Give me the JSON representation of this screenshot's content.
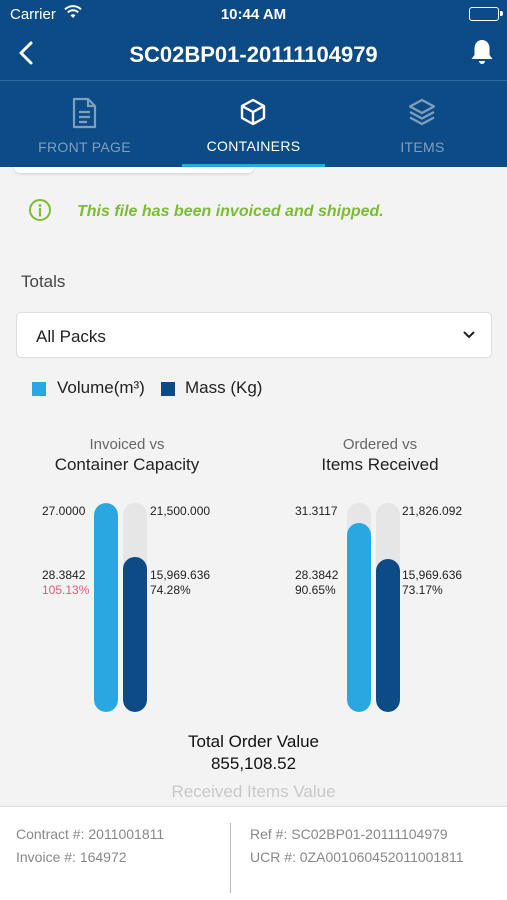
{
  "status_bar": {
    "carrier": "Carrier",
    "time": "10:44 AM"
  },
  "header": {
    "title": "SC02BP01-20111104979"
  },
  "tabs": [
    {
      "label": "FRONT PAGE",
      "icon": "document-icon",
      "active": false
    },
    {
      "label": "CONTAINERS",
      "icon": "box-icon",
      "active": true
    },
    {
      "label": "ITEMS",
      "icon": "layers-icon",
      "active": false
    }
  ],
  "notice": {
    "text": "This file has been invoiced and shipped.",
    "color": "#7bbc32"
  },
  "totals_label": "Totals",
  "pack_select": {
    "value": "All Packs"
  },
  "legend": [
    {
      "label": "Volume(m³)",
      "color": "#29a8e0"
    },
    {
      "label": "Mass (Kg)",
      "color": "#0d4b86"
    }
  ],
  "chart_data": [
    {
      "type": "bar",
      "title_line1": "Invoiced vs",
      "title_line2": "Container Capacity",
      "volume": {
        "top_label": "27.0000",
        "value_label": "28.3842",
        "percent_label": "105.13%",
        "fill": 1.0
      },
      "mass": {
        "top_label": "21,500.000",
        "value_label": "15,969.636",
        "percent_label": "74.28%",
        "fill": 0.7428
      }
    },
    {
      "type": "bar",
      "title_line1": "Ordered vs",
      "title_line2": "Items Received",
      "volume": {
        "top_label": "31.3117",
        "value_label": "28.3842",
        "percent_label": "90.65%",
        "fill": 0.9065
      },
      "mass": {
        "top_label": "21,826.092",
        "value_label": "15,969.636",
        "percent_label": "73.17%",
        "fill": 0.7317
      }
    }
  ],
  "total_order_value": {
    "label": "Total Order Value",
    "value": "855,108.52"
  },
  "received_items_value": {
    "label": "Received Items Value"
  },
  "footer": {
    "contract": "Contract #: 2011001811",
    "invoice": "Invoice #: 164972",
    "ref": "Ref #: SC02BP01-20111104979",
    "ucr": "UCR #: 0ZA001060452011001811"
  }
}
